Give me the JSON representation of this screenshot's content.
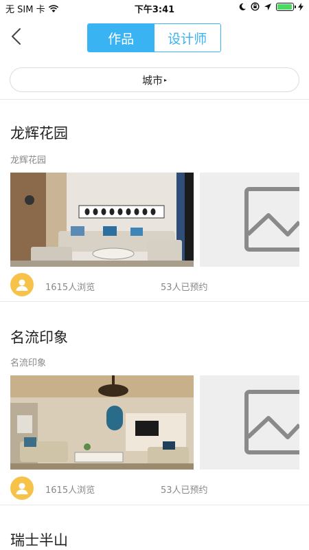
{
  "status_bar": {
    "carrier": "无 SIM 卡",
    "time": "下午3:41",
    "battery_level": 0.95
  },
  "nav": {
    "back_icon": "chevron-left-icon",
    "tabs": [
      {
        "label": "作品",
        "active": true
      },
      {
        "label": "设计师",
        "active": false
      }
    ]
  },
  "filter": {
    "city_label": "城市",
    "caret": "▸"
  },
  "colors": {
    "accent": "#39b3f2",
    "avatar": "#f7c24a",
    "muted_text": "#888888"
  },
  "projects": [
    {
      "title": "龙辉花园",
      "subtitle": "龙辉花园",
      "views": "1615人浏览",
      "bookings": "53人已预约"
    },
    {
      "title": "名流印象",
      "subtitle": "名流印象",
      "views": "1615人浏览",
      "bookings": "53人已预约"
    },
    {
      "title": "瑞士半山"
    }
  ]
}
